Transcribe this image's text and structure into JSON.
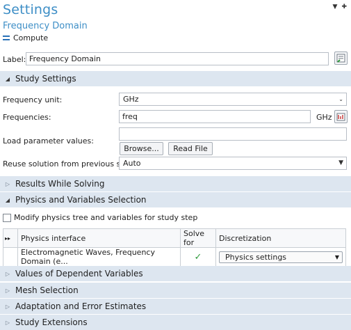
{
  "header": {
    "title": "Settings",
    "subtitle": "Frequency Domain",
    "compute_label": "Compute"
  },
  "label_field": {
    "label": "Label:",
    "value": "Frequency Domain"
  },
  "sections": {
    "study_settings": "Study Settings",
    "results_while_solving": "Results While Solving",
    "physics_and_variables": "Physics and Variables Selection",
    "values_dependent": "Values of Dependent Variables",
    "mesh_selection": "Mesh Selection",
    "adaptation": "Adaptation and Error Estimates",
    "study_extensions": "Study Extensions"
  },
  "study_settings": {
    "frequency_unit_label": "Frequency unit:",
    "frequency_unit_value": "GHz",
    "frequencies_label": "Frequencies:",
    "frequencies_value": "freq",
    "frequencies_unit": "GHz",
    "load_param_label": "Load parameter values:",
    "load_param_value": "",
    "browse_button": "Browse...",
    "read_file_button": "Read File",
    "reuse_label": "Reuse solution from previous step:",
    "reuse_value": "Auto"
  },
  "physics_selection": {
    "modify_checkbox_label": "Modify physics tree and variables for study step",
    "table": {
      "headers": [
        "Physics interface",
        "Solve for",
        "Discretization"
      ],
      "rows": [
        {
          "interface": "Electromagnetic Waves, Frequency Domain (e...",
          "solve_for": true,
          "discretization": "Physics settings"
        }
      ]
    }
  },
  "icons": {
    "compute": "equals-compute-icon",
    "label_edit": "edit-label-icon",
    "range": "range-icon"
  }
}
